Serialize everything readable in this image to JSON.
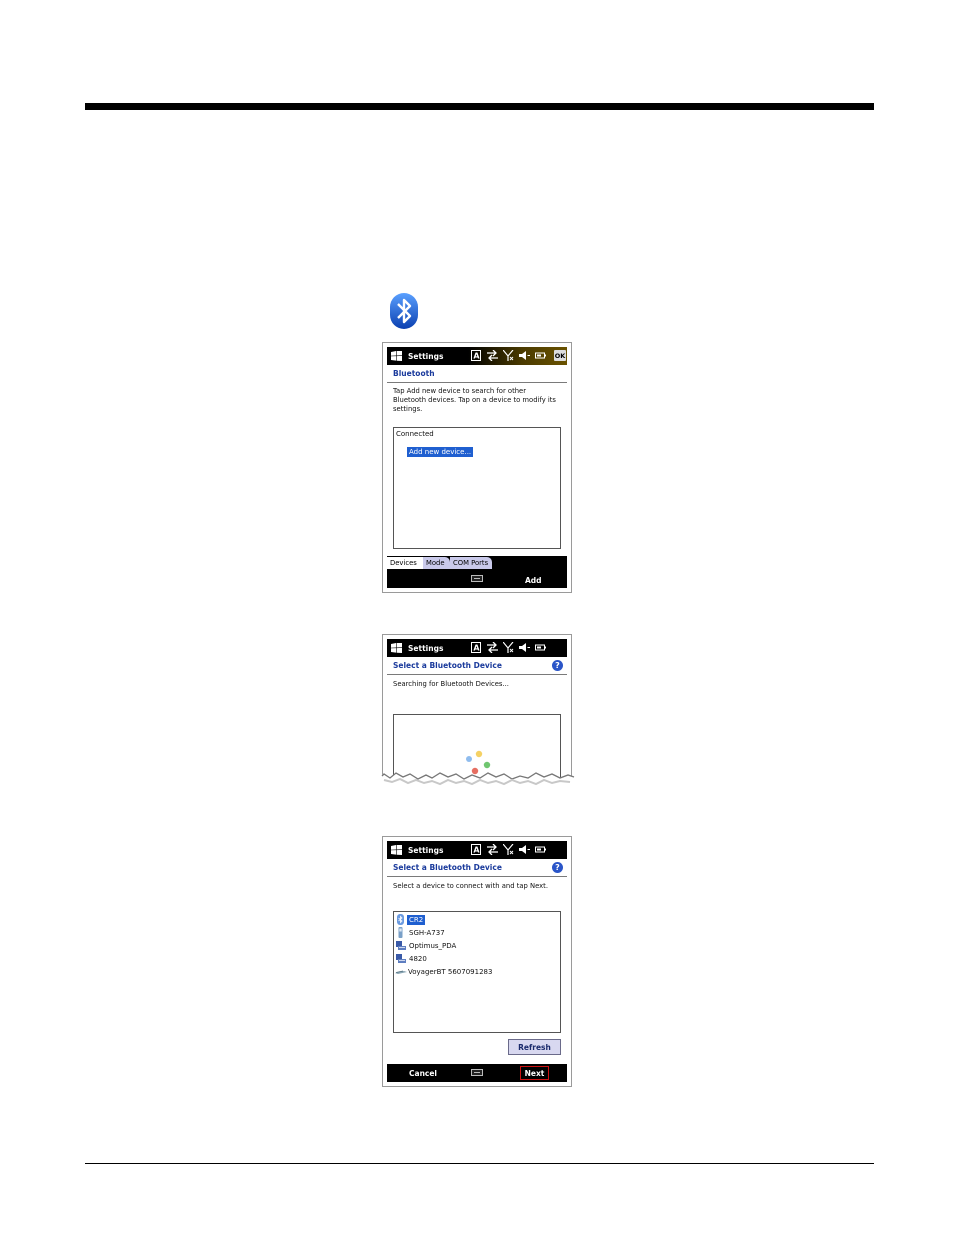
{
  "colors": {
    "accent": "#1a3a9c",
    "selection": "#1f5fd0",
    "tab_inactive": "#c9c9ea",
    "refresh_button": "#d8d8f0",
    "next_highlight": "#cc1111"
  },
  "screen1": {
    "status_title": "Settings",
    "ok_label": "OK",
    "header": "Bluetooth",
    "instructions": "Tap Add new device to search for other Bluetooth devices. Tap on a device to modify its settings.",
    "list_group": "Connected",
    "list_item": "Add new device...",
    "tabs": [
      "Devices",
      "Mode",
      "COM Ports"
    ],
    "right_soft": "Add"
  },
  "screen2": {
    "status_title": "Settings",
    "header": "Select a Bluetooth Device",
    "help": "?",
    "instructions": "Searching for Bluetooth Devices..."
  },
  "screen3": {
    "status_title": "Settings",
    "header": "Select a Bluetooth Device",
    "help": "?",
    "instructions": "Select a device to connect with and tap Next.",
    "devices": [
      {
        "name": "CR2",
        "icon": "bluetooth-device-icon",
        "selected": true
      },
      {
        "name": "SGH-A737",
        "icon": "phone-icon",
        "selected": false
      },
      {
        "name": "Optimus_PDA",
        "icon": "computer-icon",
        "selected": false
      },
      {
        "name": "4820",
        "icon": "computer-icon",
        "selected": false
      },
      {
        "name": "VoyagerBT 5607091283",
        "icon": "headset-icon",
        "selected": false
      }
    ],
    "refresh": "Refresh",
    "left_soft": "Cancel",
    "right_soft": "Next"
  }
}
